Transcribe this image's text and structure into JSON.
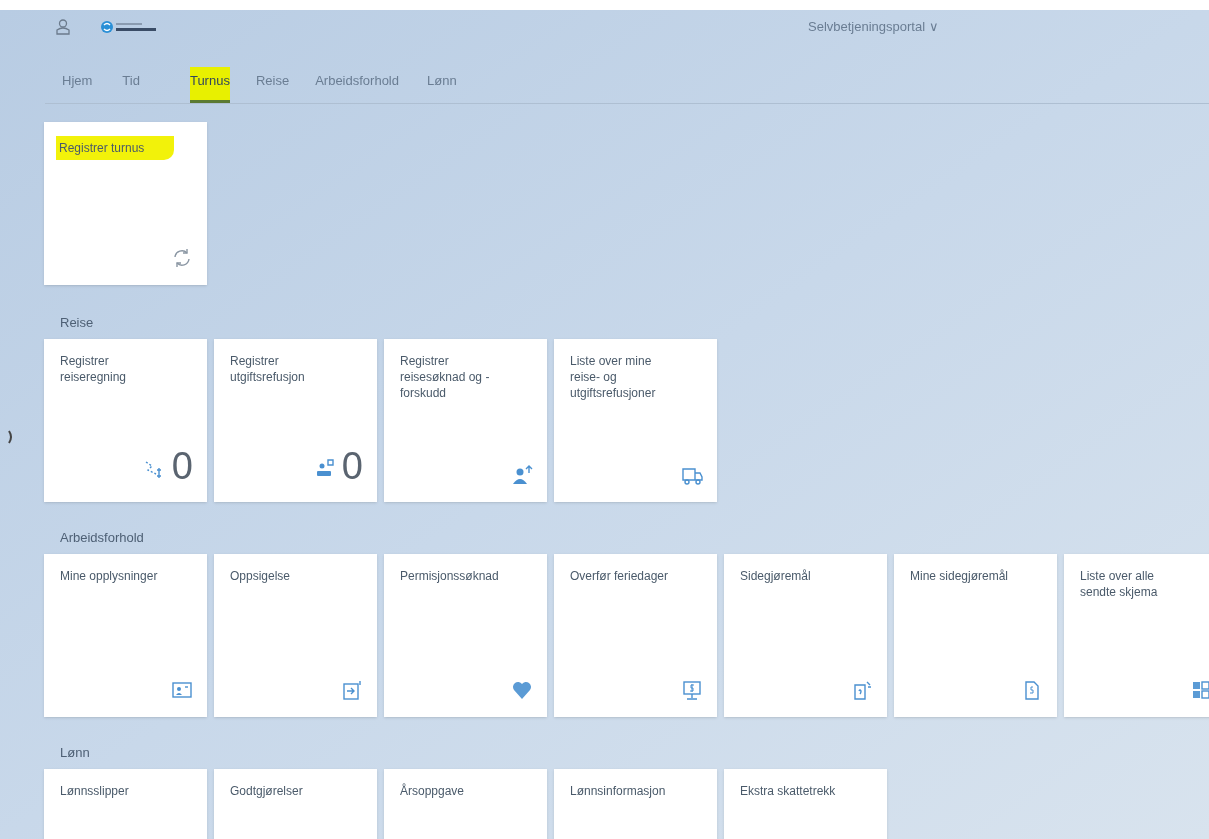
{
  "header": {
    "portal_title": "Selvbetjeningsportal",
    "portal_caret": "∨"
  },
  "tabs": [
    {
      "label": "Hjem",
      "selected": false,
      "highlighted": false
    },
    {
      "label": "Tid",
      "selected": false,
      "highlighted": false
    },
    {
      "label": "Turnus",
      "selected": true,
      "highlighted": true
    },
    {
      "label": "Reise",
      "selected": false,
      "highlighted": false
    },
    {
      "label": "Arbeidsforhold",
      "selected": false,
      "highlighted": false
    },
    {
      "label": "Lønn",
      "selected": false,
      "highlighted": false
    }
  ],
  "groups": [
    {
      "tiles": [
        {
          "title": "Registrer turnus",
          "kind": "refresh",
          "highlighted": true
        }
      ]
    },
    {
      "title": "Reise",
      "tiles": [
        {
          "title": "Registrer reiseregning",
          "kind": "expense",
          "number": "0",
          "highlighted": false
        },
        {
          "title": "Registrer utgiftsrefusjon",
          "kind": "refund",
          "number": "0",
          "highlighted": false
        },
        {
          "title": "Registrer reisesøknad og - forskudd",
          "kind": "person-up",
          "highlighted": false
        },
        {
          "title": "Liste over mine reise- og utgiftsrefusjoner",
          "kind": "truck",
          "highlighted": false
        }
      ]
    },
    {
      "title": "Arbeidsforhold",
      "tiles": [
        {
          "title": "Mine opplysninger",
          "kind": "idcard",
          "highlighted": false
        },
        {
          "title": "Oppsigelse",
          "kind": "exit",
          "highlighted": false
        },
        {
          "title": "Permisjonssøknad",
          "kind": "heart",
          "highlighted": false
        },
        {
          "title": "Overfør feriedager",
          "kind": "monitor",
          "highlighted": false
        },
        {
          "title": "Sidegjøremål",
          "kind": "docq",
          "highlighted": false
        },
        {
          "title": "Mine sidegjøremål",
          "kind": "docd",
          "highlighted": false
        },
        {
          "title": "Liste over alle sendte skjema",
          "kind": "grid",
          "highlighted": false
        }
      ]
    },
    {
      "title": "Lønn",
      "tiles": [
        {
          "title": "Lønnsslipper",
          "highlighted": false
        },
        {
          "title": "Godtgjørelser",
          "highlighted": false
        },
        {
          "title": "Årsoppgave",
          "highlighted": false
        },
        {
          "title": "Lønnsinformasjon",
          "highlighted": false
        },
        {
          "title": "Ekstra skattetrekk",
          "highlighted": false
        }
      ]
    }
  ]
}
